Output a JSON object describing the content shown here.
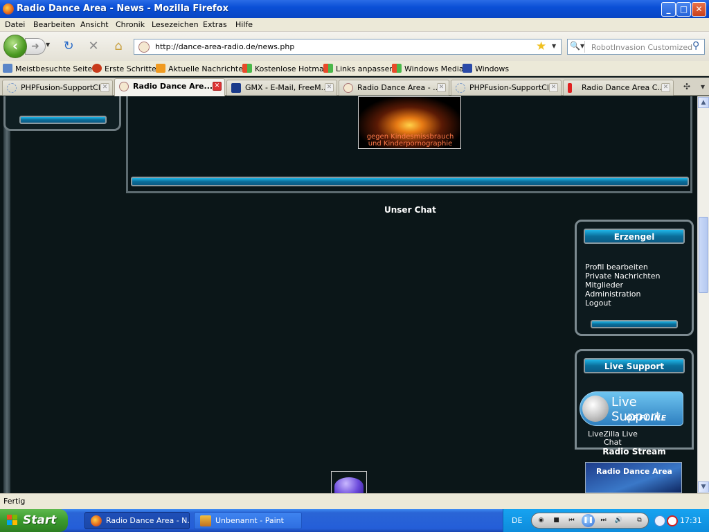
{
  "window": {
    "title": "Radio Dance Area - News - Mozilla Firefox",
    "buttons": {
      "minimize": "_",
      "maximize": "□",
      "close": "✕"
    }
  },
  "menubar": {
    "items": [
      "Datei",
      "Bearbeiten",
      "Ansicht",
      "Chronik",
      "Lesezeichen",
      "Extras",
      "Hilfe"
    ]
  },
  "navbar": {
    "url": "http://dance-area-radio.de/news.php",
    "search_placeholder": "RobotInvasion Customized We",
    "icons": [
      "back-icon",
      "forward-icon",
      "reload-icon",
      "stop-icon",
      "home-icon",
      "bookmark-star-icon",
      "search-icon"
    ]
  },
  "bookmarks": [
    "Meistbesuchte Seiten",
    "Erste Schritte",
    "Aktuelle Nachrichten",
    "Kostenlose Hotmail",
    "Links anpassen",
    "Windows Media",
    "Windows"
  ],
  "tabs": [
    {
      "label": "PHPFusion-SupportCl...",
      "active": false
    },
    {
      "label": "Radio Dance Are...",
      "active": true
    },
    {
      "label": "GMX - E-Mail, FreeM...",
      "active": false
    },
    {
      "label": "Radio Dance Area - ...",
      "active": false
    },
    {
      "label": "PHPFusion-SupportCl...",
      "active": false
    },
    {
      "label": "Radio Dance Area C...",
      "active": false
    }
  ],
  "content": {
    "banner_text_1": "gegen Kindesmissbrauch",
    "banner_text_2": "und Kinderpornographie",
    "chat_heading": "Unser Chat",
    "user_box": {
      "title": "Erzengel",
      "links": [
        "Profil bearbeiten",
        "Private Nachrichten",
        "Mitglieder",
        "Administration",
        "Logout"
      ]
    },
    "support_box": {
      "title": "Live Support",
      "image_big": "Live Support",
      "image_small": "OFFLINE",
      "caption_1": "LiveZilla Live",
      "caption_2": "Chat"
    },
    "radio_heading": "Radio Stream",
    "radio_image_text": "Radio Dance Area"
  },
  "statusbar": {
    "text": "Fertig"
  },
  "taskbar": {
    "start": "Start",
    "items": [
      {
        "label": "Radio Dance Area - N...",
        "active": true
      },
      {
        "label": "Unbenannt - Paint",
        "active": false
      }
    ],
    "language": "DE",
    "clock": "17:31"
  }
}
